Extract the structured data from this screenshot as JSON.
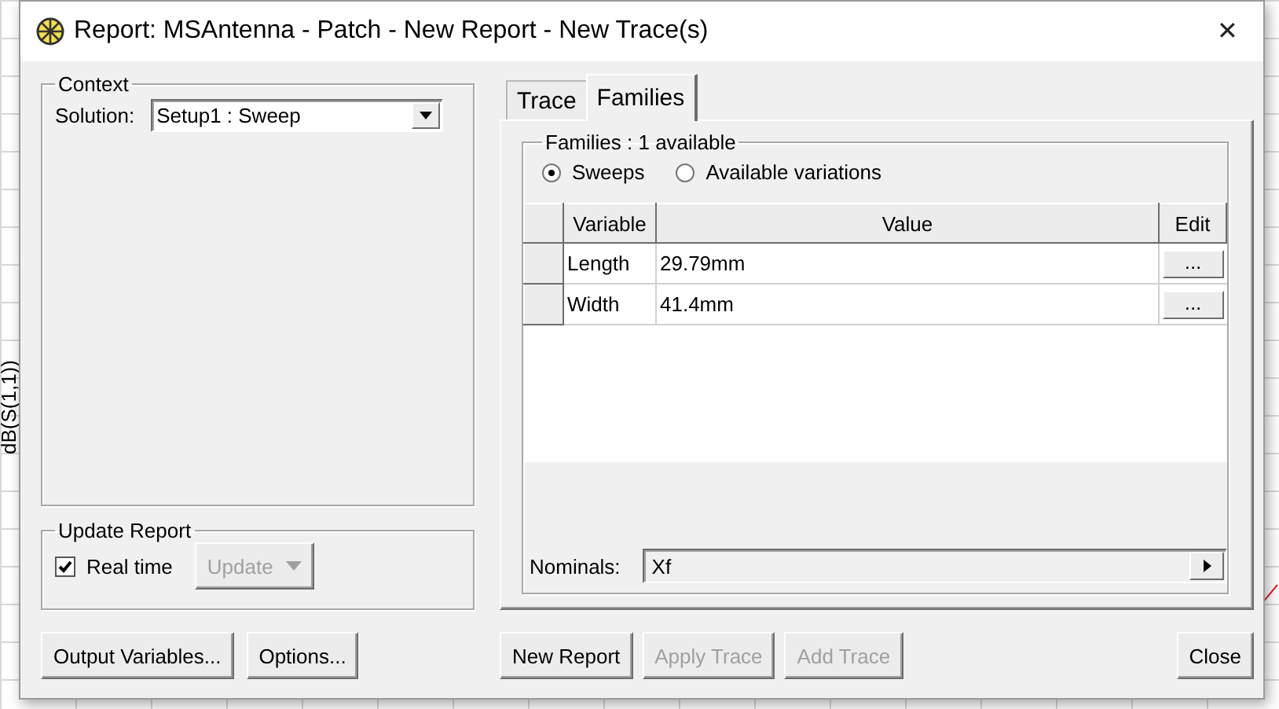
{
  "background": {
    "axis_label": "dB(S(1,1))"
  },
  "window": {
    "title": "Report: MSAntenna - Patch - New Report - New Trace(s)",
    "close_label": "✕"
  },
  "context": {
    "title": "Context",
    "solution_label": "Solution:",
    "solution_value": "Setup1 : Sweep"
  },
  "update_report": {
    "title": "Update Report",
    "real_time": {
      "label": "Real time",
      "checked": true
    },
    "update_button": {
      "label": "Update",
      "disabled": true
    }
  },
  "left_buttons": [
    {
      "label": "Output Variables...",
      "disabled": false
    },
    {
      "label": "Options...",
      "disabled": false
    }
  ],
  "tabs": [
    {
      "label": "Trace",
      "selected": false
    },
    {
      "label": "Families",
      "selected": true
    }
  ],
  "families": {
    "title": "Families : 1 available",
    "modes": [
      {
        "label": "Sweeps",
        "selected": true
      },
      {
        "label": "Available variations",
        "selected": false
      }
    ],
    "table": {
      "columns": [
        "Variable",
        "Value",
        "Edit"
      ],
      "rows": [
        {
          "variable": "Length",
          "value": "29.79mm",
          "edit": "..."
        },
        {
          "variable": "Width",
          "value": "41.4mm",
          "edit": "..."
        }
      ]
    },
    "nominals_label": "Nominals:",
    "nominals_value": "Xf"
  },
  "bottom_buttons": [
    {
      "label": "New Report",
      "disabled": false
    },
    {
      "label": "Apply Trace",
      "disabled": true
    },
    {
      "label": "Add Trace",
      "disabled": true
    }
  ],
  "close_button": {
    "label": "Close",
    "disabled": false
  }
}
